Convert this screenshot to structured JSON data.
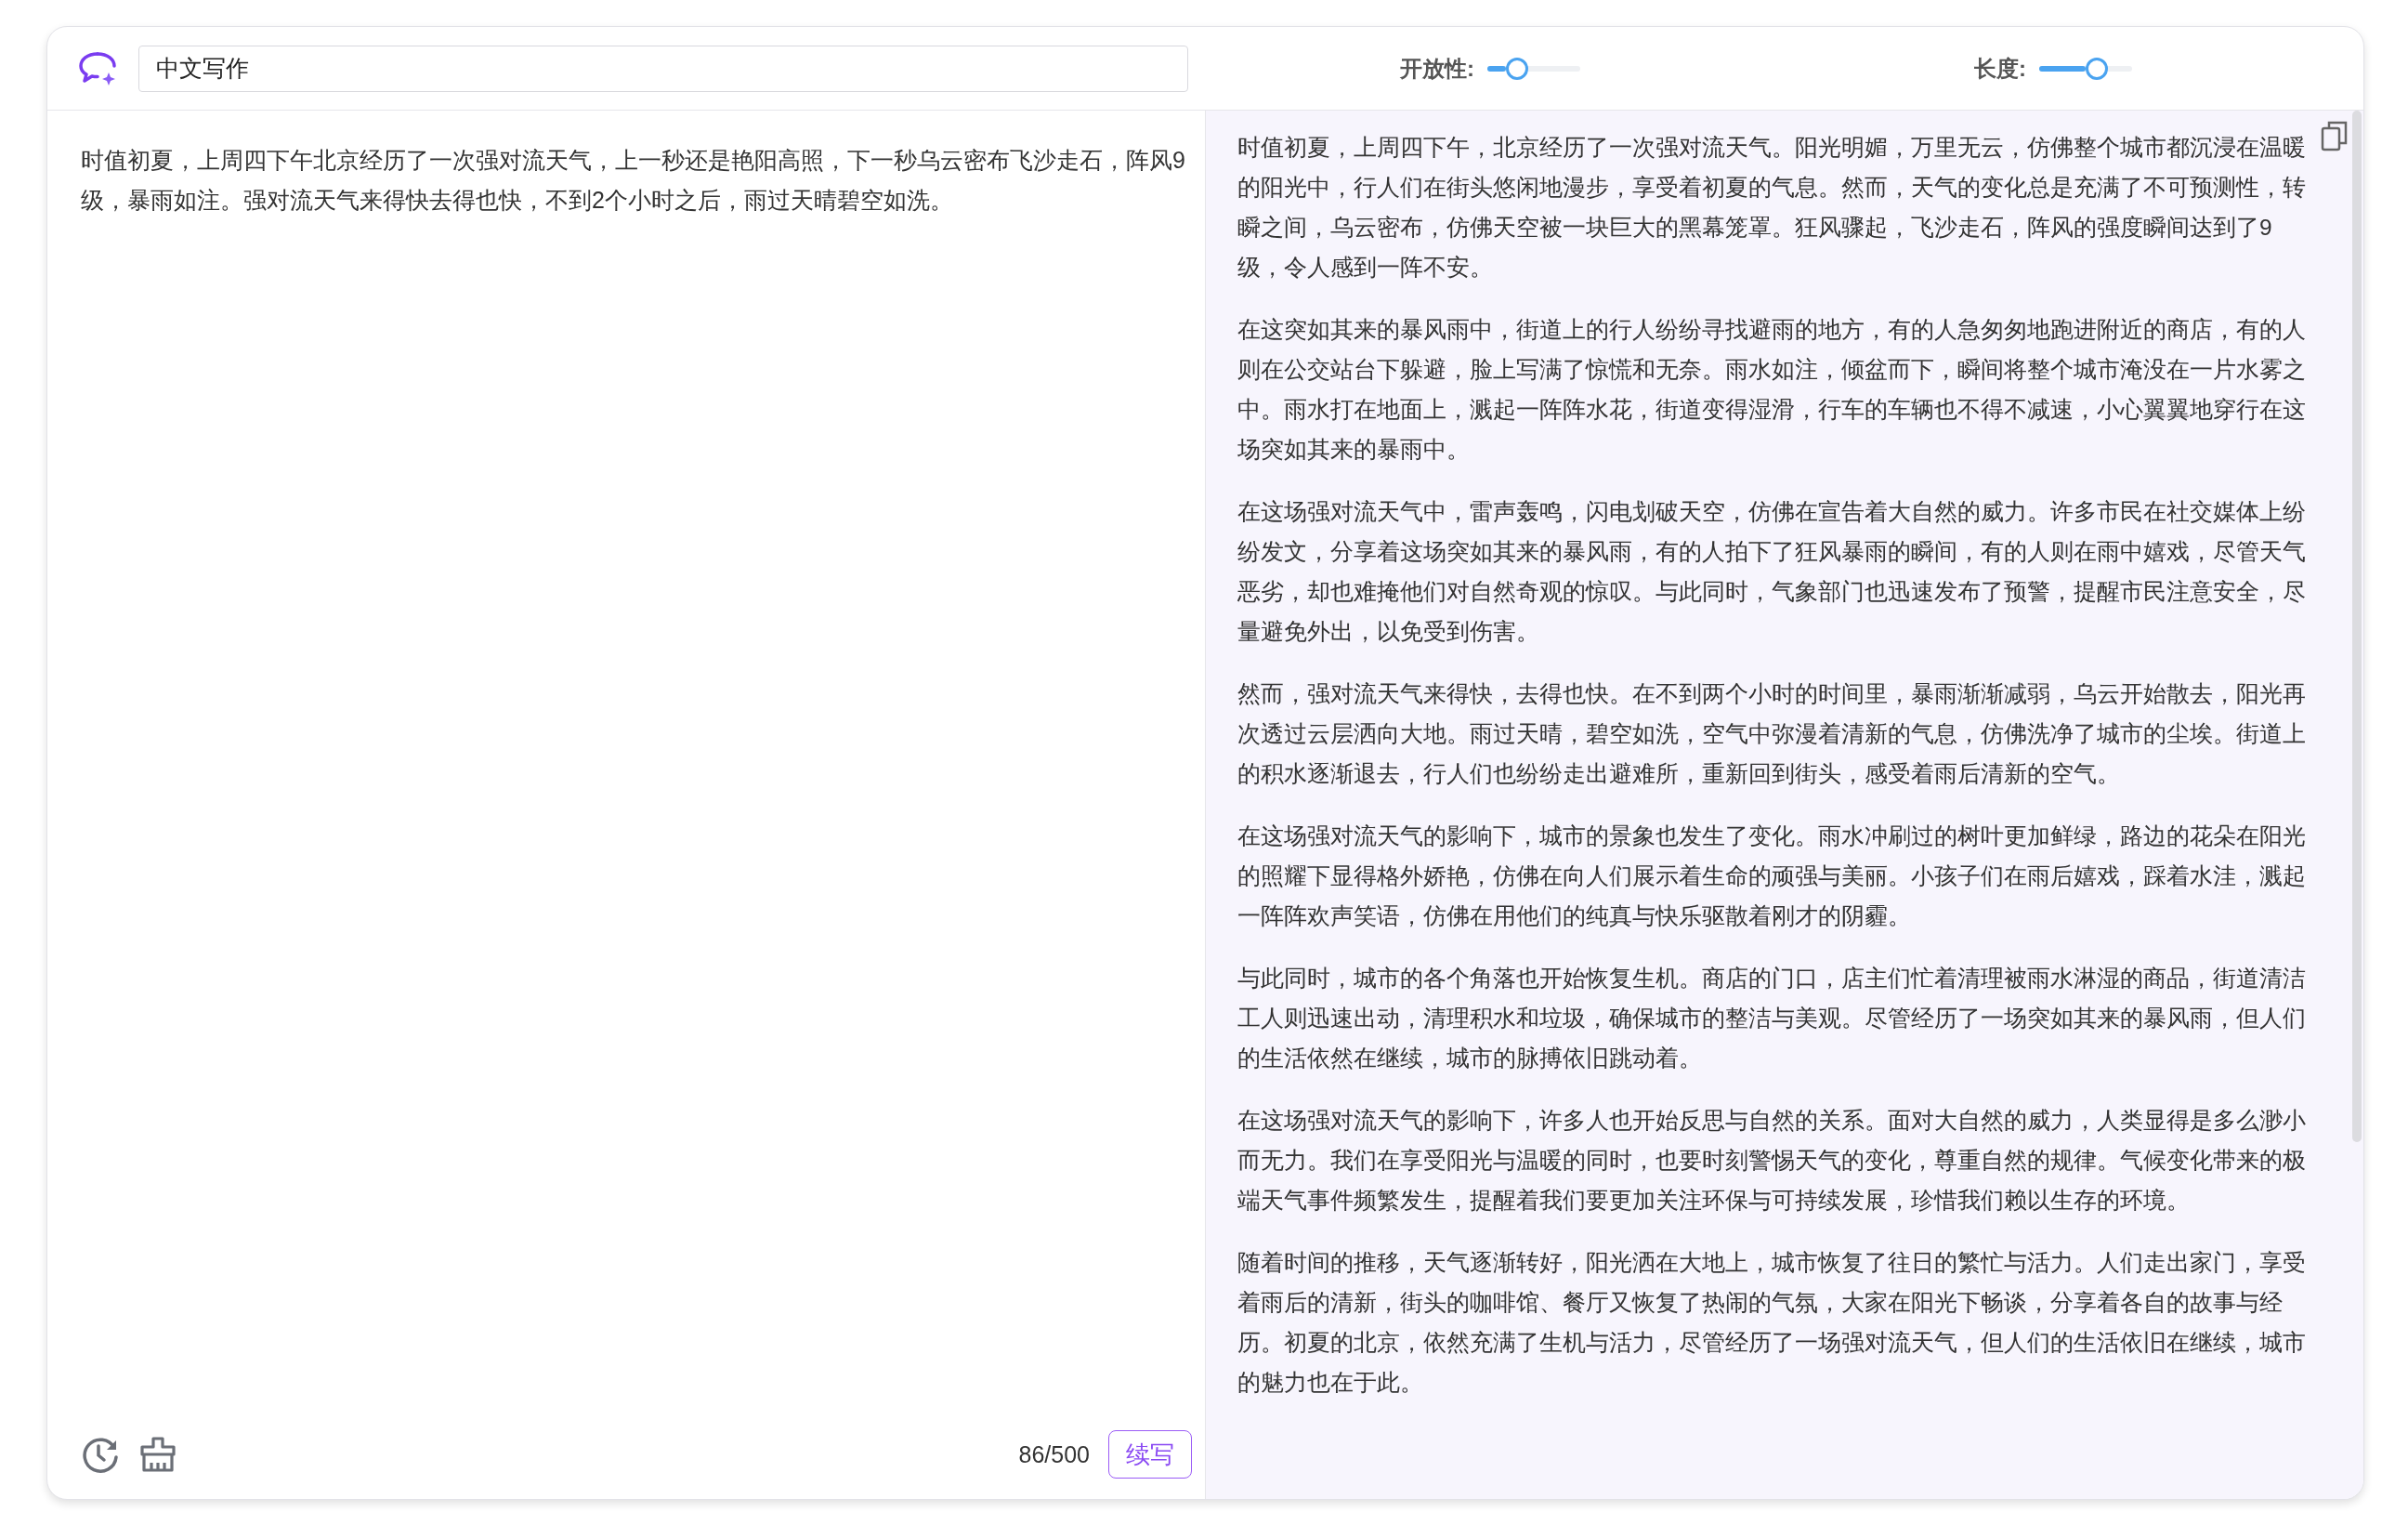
{
  "header": {
    "title_field": {
      "value": "中文写作"
    },
    "sliders": [
      {
        "label": "开放性:",
        "level": 0.2
      },
      {
        "label": "长度:",
        "level": 0.5
      }
    ]
  },
  "input_panel": {
    "text": "时值初夏，上周四下午北京经历了一次强对流天气，上一秒还是艳阳高照，下一秒乌云密布飞沙走石，阵风9级，暴雨如注。强对流天气来得快去得也快，不到2个小时之后，雨过天晴碧空如洗。",
    "counter": "86/500",
    "button": "续写"
  },
  "output_panel": {
    "paragraphs": [
      "时值初夏，上周四下午，北京经历了一次强对流天气。阳光明媚，万里无云，仿佛整个城市都沉浸在温暖的阳光中，行人们在街头悠闲地漫步，享受着初夏的气息。然而，天气的变化总是充满了不可预测性，转瞬之间，乌云密布，仿佛天空被一块巨大的黑幕笼罩。狂风骤起，飞沙走石，阵风的强度瞬间达到了9级，令人感到一阵不安。",
      "在这突如其来的暴风雨中，街道上的行人纷纷寻找避雨的地方，有的人急匆匆地跑进附近的商店，有的人则在公交站台下躲避，脸上写满了惊慌和无奈。雨水如注，倾盆而下，瞬间将整个城市淹没在一片水雾之中。雨水打在地面上，溅起一阵阵水花，街道变得湿滑，行车的车辆也不得不减速，小心翼翼地穿行在这场突如其来的暴雨中。",
      "在这场强对流天气中，雷声轰鸣，闪电划破天空，仿佛在宣告着大自然的威力。许多市民在社交媒体上纷纷发文，分享着这场突如其来的暴风雨，有的人拍下了狂风暴雨的瞬间，有的人则在雨中嬉戏，尽管天气恶劣，却也难掩他们对自然奇观的惊叹。与此同时，气象部门也迅速发布了预警，提醒市民注意安全，尽量避免外出，以免受到伤害。",
      "然而，强对流天气来得快，去得也快。在不到两个小时的时间里，暴雨渐渐减弱，乌云开始散去，阳光再次透过云层洒向大地。雨过天晴，碧空如洗，空气中弥漫着清新的气息，仿佛洗净了城市的尘埃。街道上的积水逐渐退去，行人们也纷纷走出避难所，重新回到街头，感受着雨后清新的空气。",
      "在这场强对流天气的影响下，城市的景象也发生了变化。雨水冲刷过的树叶更加鲜绿，路边的花朵在阳光的照耀下显得格外娇艳，仿佛在向人们展示着生命的顽强与美丽。小孩子们在雨后嬉戏，踩着水洼，溅起一阵阵欢声笑语，仿佛在用他们的纯真与快乐驱散着刚才的阴霾。",
      "与此同时，城市的各个角落也开始恢复生机。商店的门口，店主们忙着清理被雨水淋湿的商品，街道清洁工人则迅速出动，清理积水和垃圾，确保城市的整洁与美观。尽管经历了一场突如其来的暴风雨，但人们的生活依然在继续，城市的脉搏依旧跳动着。",
      "在这场强对流天气的影响下，许多人也开始反思与自然的关系。面对大自然的威力，人类显得是多么渺小而无力。我们在享受阳光与温暖的同时，也要时刻警惕天气的变化，尊重自然的规律。气候变化带来的极端天气事件频繁发生，提醒着我们要更加关注环保与可持续发展，珍惜我们赖以生存的环境。",
      "随着时间的推移，天气逐渐转好，阳光洒在大地上，城市恢复了往日的繁忙与活力。人们走出家门，享受着雨后的清新，街头的咖啡馆、餐厅又恢复了热闹的气氛，大家在阳光下畅谈，分享着各自的故事与经历。初夏的北京，依然充满了生机与活力，尽管经历了一场强对流天气，但人们的生活依旧在继续，城市的魅力也在于此。"
    ]
  }
}
